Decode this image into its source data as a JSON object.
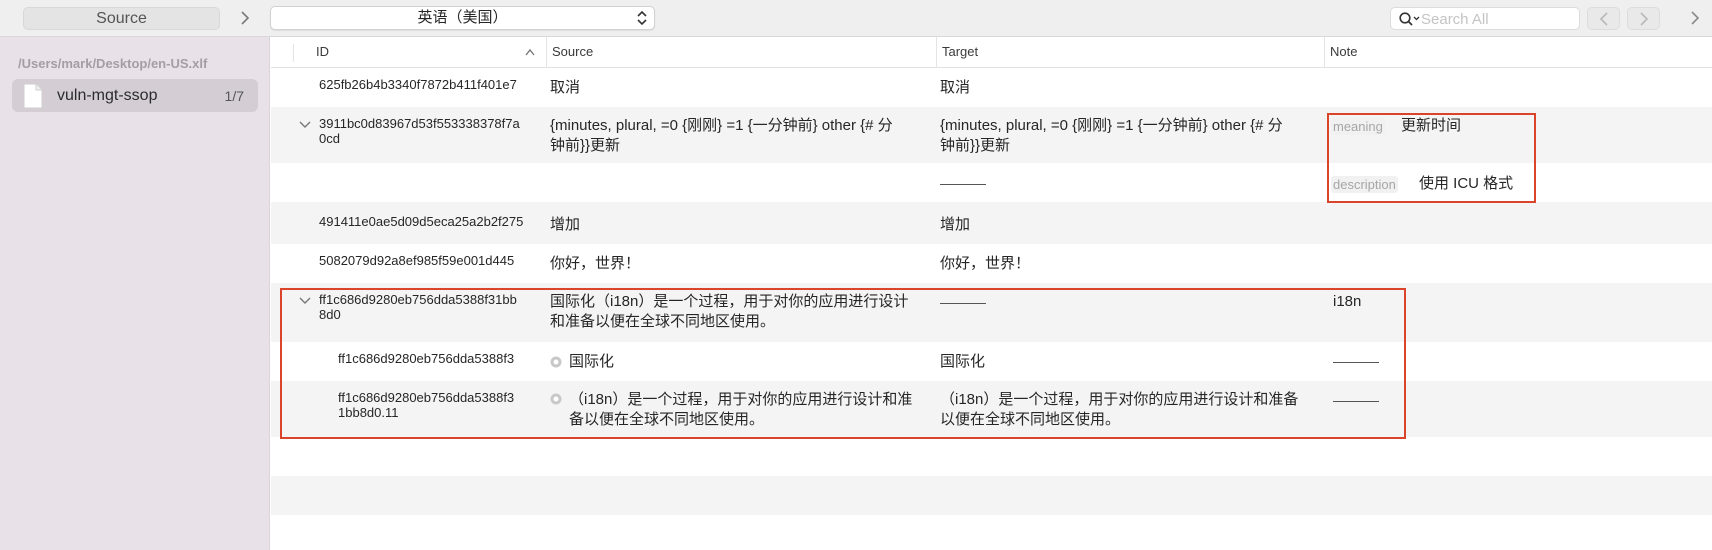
{
  "toolbar": {
    "source_label": "Source",
    "language": "英语（美国）",
    "search_placeholder": "Search All"
  },
  "sidebar": {
    "path": "/Users/mark/Desktop/en-US.xlf",
    "files": [
      {
        "name": "vuln-mgt-ssop",
        "count": "1/7"
      }
    ]
  },
  "table": {
    "columns": {
      "id": "ID",
      "source": "Source",
      "target": "Target",
      "note": "Note"
    },
    "rows": [
      {
        "id": "625fb26b4b3340f7872b411f401e7",
        "source": "取消",
        "target": "取消"
      },
      {
        "id": "3911bc0d83967d53f553338378f7a0cd",
        "id_line1": "3911bc0d83967d53f553338378f7a",
        "id_line2": "0cd",
        "source_line1": "{minutes, plural, =0 {刚刚} =1 {一分钟前} other {# 分",
        "source_line2": "钟前}}更新",
        "target_line1": "{minutes, plural, =0 {刚刚} =1 {一分钟前} other {# 分",
        "target_line2": "钟前}}更新",
        "note_meaning_tag": "meaning",
        "note_meaning": "更新时间",
        "note_description_tag": "description",
        "note_description": "使用 ICU 格式"
      },
      {
        "id": "491411e0ae5d09d5eca25a2b2f275",
        "source": "增加",
        "target": "增加"
      },
      {
        "id": "5082079d92a8ef985f59e001d445",
        "source": "你好，世界！",
        "target": "你好，世界！"
      },
      {
        "id_line1": "ff1c686d9280eb756dda5388f31bb",
        "id_line2": "8d0",
        "source_line1": "国际化（i18n）是一个过程，用于对你的应用进行设计",
        "source_line2": "和准备以便在全球不同地区使用。",
        "note": "i18n"
      },
      {
        "id": "ff1c686d9280eb756dda5388f3",
        "source": "国际化",
        "target": "国际化"
      },
      {
        "id_line1": "ff1c686d9280eb756dda5388f3",
        "id_line2": "1bb8d0.11",
        "source_line1": "（i18n）是一个过程，用于对你的应用进行设计和准",
        "source_line2": "备以便在全球不同地区使用。",
        "target_line1": "（i18n）是一个过程，用于对你的应用进行设计和准备",
        "target_line2": "以便在全球不同地区使用。"
      }
    ]
  },
  "colors": {
    "sidebar_bg": "#e8e2e8",
    "selection_bg": "#d4ced4",
    "highlight": "#d9442b",
    "row_alt": "#f4f4f4"
  }
}
